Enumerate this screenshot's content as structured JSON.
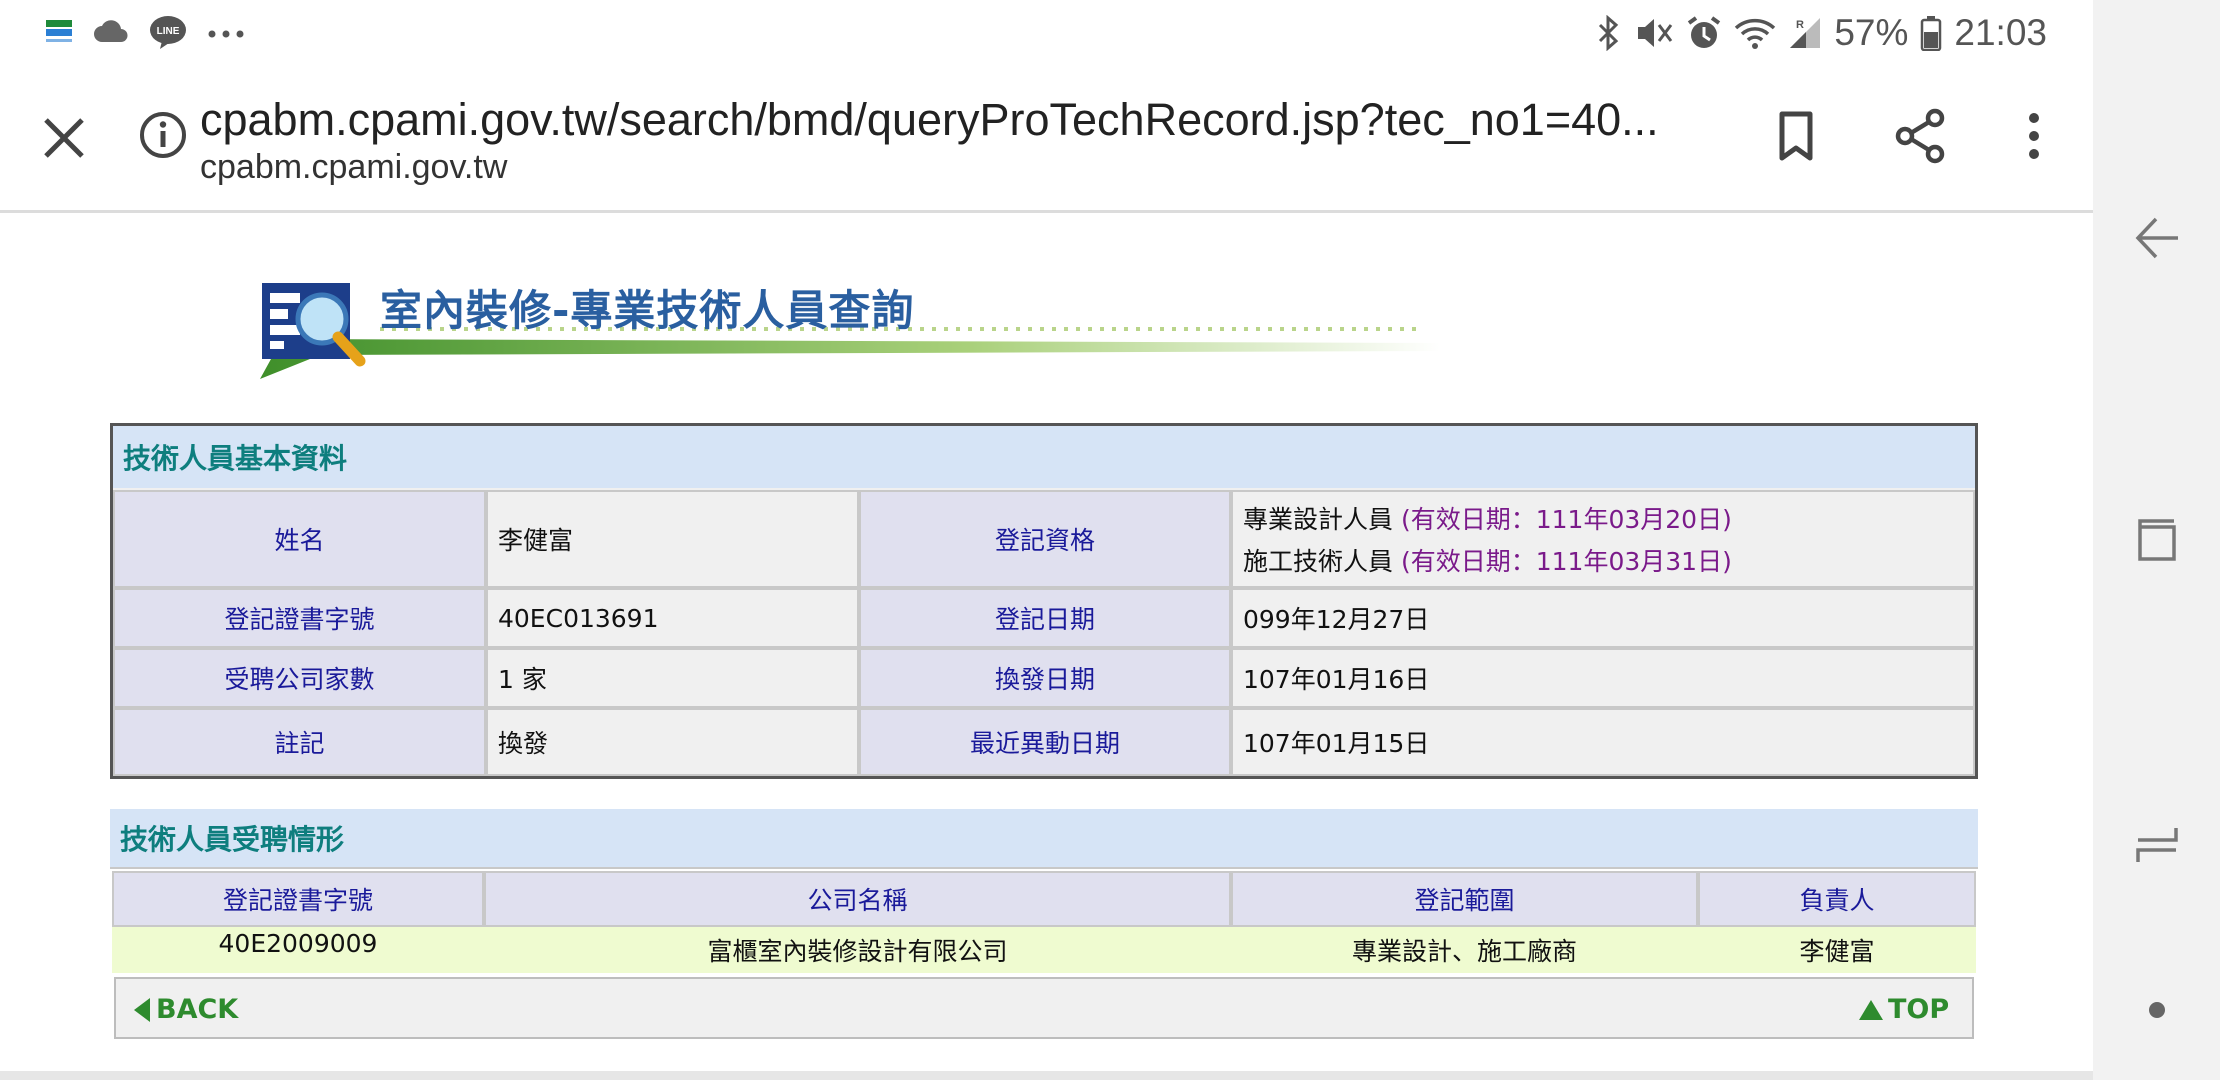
{
  "status_bar": {
    "battery": "57%",
    "time": "21:03",
    "icons_left": [
      "familymart-icon",
      "cloud-icon",
      "line-icon",
      "more-dots-icon"
    ],
    "icons_right": [
      "bluetooth-icon",
      "mute-icon",
      "alarm-icon",
      "wifi-icon",
      "signal-icon",
      "battery-icon"
    ],
    "line_label": "LINE"
  },
  "browser": {
    "url": "cpabm.cpami.gov.tw/search/bmd/queryProTechRecord.jsp?tec_no1=40...",
    "domain": "cpabm.cpami.gov.tw"
  },
  "page": {
    "title": "室內裝修-專業技術人員查詢"
  },
  "basic_info": {
    "section_title": "技術人員基本資料",
    "name_label": "姓名",
    "name_value": "李健富",
    "qual_label": "登記資格",
    "qual_line1": "專業設計人員",
    "qual_line1_date": "(有效日期：111年03月20日)",
    "qual_line2": "施工技術人員",
    "qual_line2_date": "(有效日期：111年03月31日)",
    "cert_label": "登記證書字號",
    "cert_value": "40EC013691",
    "reg_date_label": "登記日期",
    "reg_date_value": "099年12月27日",
    "company_count_label": "受聘公司家數",
    "company_count_value": "1 家",
    "reissue_label": "換發日期",
    "reissue_value": "107年01月16日",
    "note_label": "註記",
    "note_value": "換發",
    "recent_change_label": "最近異動日期",
    "recent_change_value": "107年01月15日"
  },
  "employment": {
    "section_title": "技術人員受聘情形",
    "headers": [
      "登記證書字號",
      "公司名稱",
      "登記範圍",
      "負責人"
    ],
    "rows": [
      [
        "40E2009009",
        "富櫃室內裝修設計有限公司",
        "專業設計、施工廠商",
        "李健富"
      ]
    ]
  },
  "footer": {
    "back": "BACK",
    "top": "TOP"
  },
  "colors": {
    "section_bg": "#d6e4f6",
    "section_text": "#0e7e7e",
    "label_bg": "#e0e0ef",
    "label_text": "#1a1a9a",
    "date_purple": "#7a1a8a",
    "row_green": "#effbd0",
    "link_green": "#2e8b2e",
    "title_blue": "#2a5fa0"
  }
}
